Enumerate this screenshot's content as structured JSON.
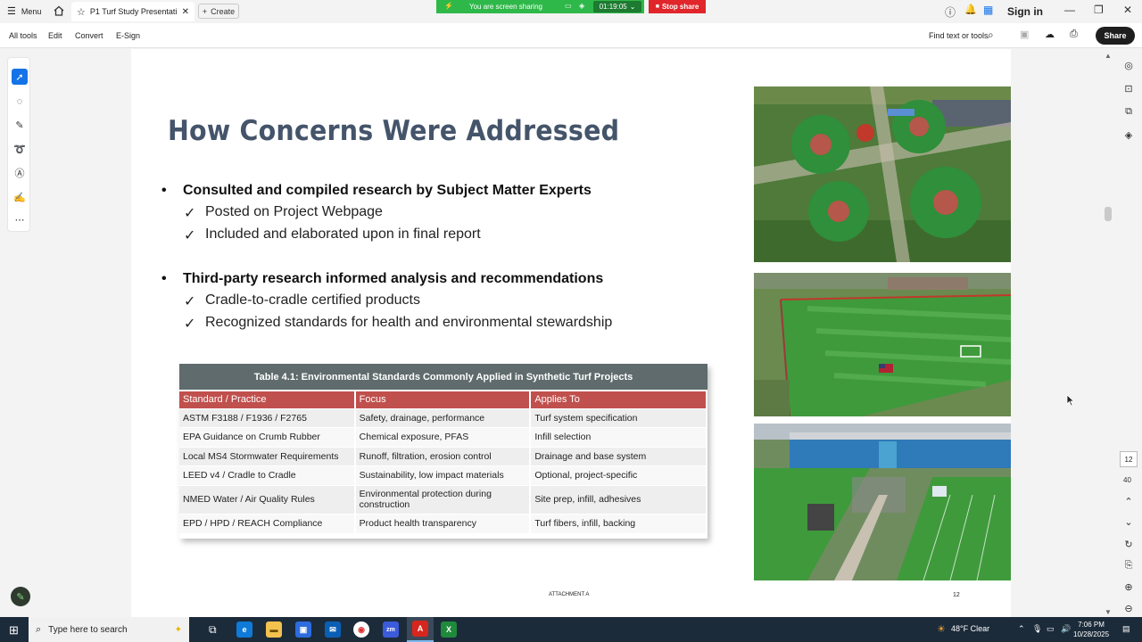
{
  "titlebar": {
    "menu_label": "Menu",
    "tab_title": "P1 Turf Study Presentati...",
    "create_label": "Create",
    "share_banner_text": "You are screen sharing",
    "timer": "01:19:05",
    "stop_share_label": "Stop share",
    "signin_label": "Sign in"
  },
  "toolbar": {
    "all_tools": "All tools",
    "edit": "Edit",
    "convert": "Convert",
    "esign": "E-Sign",
    "find_text": "Find text or tools",
    "share_label": "Share"
  },
  "slide": {
    "title": "How Concerns Were Addressed",
    "bullets": [
      {
        "text": "Consulted and compiled research by Subject Matter Experts",
        "subs": [
          "Posted on Project Webpage",
          "Included and elaborated upon in final report"
        ]
      },
      {
        "text": "Third-party research informed analysis and recommendations",
        "subs": [
          "Cradle-to-cradle certified products",
          "Recognized standards for health and environmental stewardship"
        ]
      }
    ],
    "bullet_char": "•",
    "check_char": "✓",
    "table": {
      "title": "Table 4.1: Environmental Standards Commonly Applied in Synthetic Turf Projects",
      "headers": [
        "Standard / Practice",
        "Focus",
        "Applies To"
      ],
      "rows": [
        [
          "ASTM F3188 / F1936 / F2765",
          "Safety, drainage, performance",
          "Turf system specification"
        ],
        [
          "EPA Guidance on Crumb Rubber",
          "Chemical exposure, PFAS",
          "Infill selection"
        ],
        [
          "Local MS4 Stormwater Requirements",
          "Runoff, filtration, erosion control",
          "Drainage and base system"
        ],
        [
          "LEED v4 / Cradle to Cradle",
          "Sustainability, low impact materials",
          "Optional, project-specific"
        ],
        [
          "NMED Water / Air Quality Rules",
          "Environmental protection during construction",
          "Site prep, infill, adhesives"
        ],
        [
          "EPD / HPD / REACH Compliance",
          "Product health transparency",
          "Turf fibers, infill, backing"
        ]
      ]
    },
    "footer_center": "ATTACHMENT A",
    "footer_page": "12"
  },
  "pager": {
    "current": "12",
    "total": "40"
  },
  "taskbar": {
    "search_placeholder": "Type here to search",
    "weather": "48°F  Clear",
    "time": "7:06 PM",
    "date": "10/28/2025"
  }
}
